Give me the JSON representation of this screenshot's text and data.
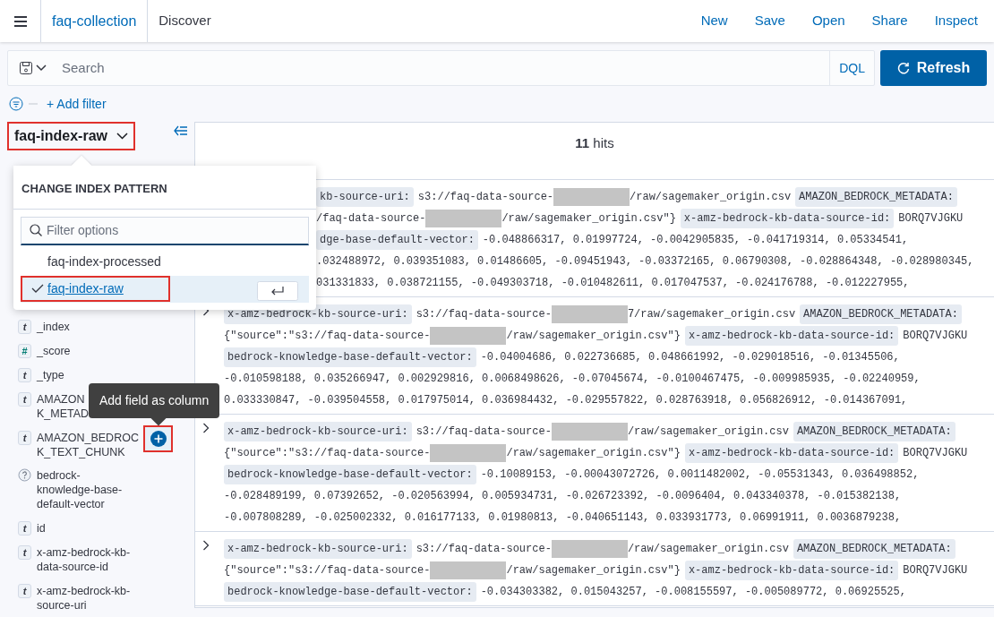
{
  "header": {
    "breadcrumbs": [
      {
        "label": "faq-collection",
        "link": true
      },
      {
        "label": "Discover",
        "link": false
      }
    ],
    "actions": [
      "New",
      "Save",
      "Open",
      "Share",
      "Inspect"
    ]
  },
  "query_bar": {
    "placeholder": "Search",
    "language": "DQL",
    "refresh": "Refresh"
  },
  "add_filter": "+ Add filter",
  "index_picker": {
    "label": "faq-index-raw",
    "highlighted": true
  },
  "popover": {
    "title": "CHANGE INDEX PATTERN",
    "placeholder": "Filter options",
    "options": [
      {
        "label": "faq-index-processed",
        "selected": false,
        "highlighted": false
      },
      {
        "label": "faq-index-raw",
        "selected": true,
        "highlighted": true
      }
    ]
  },
  "fields": [
    {
      "kind": "string",
      "badge": "t",
      "lines": [
        "_index"
      ],
      "add_button": false
    },
    {
      "kind": "number",
      "badge": "#",
      "lines": [
        "_score"
      ],
      "add_button": false
    },
    {
      "kind": "string",
      "badge": "t",
      "lines": [
        "_type"
      ],
      "add_button": false
    },
    {
      "kind": "string",
      "badge": "t",
      "lines": [
        "AMAZON",
        "K_METAD"
      ],
      "add_button": false
    },
    {
      "kind": "string",
      "badge": "t",
      "lines": [
        "AMAZON_BEDROC",
        "K_TEXT_CHUNK"
      ],
      "add_button": true,
      "highlighted": true
    },
    {
      "kind": "unknown",
      "lines": [
        "bedrock-",
        "knowledge-base-",
        "default-vector"
      ],
      "add_button": false
    },
    {
      "kind": "string",
      "badge": "t",
      "lines": [
        "id"
      ],
      "add_button": false
    },
    {
      "kind": "string",
      "badge": "t",
      "lines": [
        "x-amz-bedrock-kb-",
        "data-source-id"
      ],
      "add_button": false
    },
    {
      "kind": "string",
      "badge": "t",
      "lines": [
        "x-amz-bedrock-kb-",
        "source-uri"
      ],
      "add_button": false
    }
  ],
  "tooltip": "Add field as column",
  "hits": "**11** hits",
  "rows": [
    {
      "covered": true,
      "lines": [
        [
          {
            "kind": "chip",
            "text": "kb-source-uri:"
          },
          {
            "kind": "text",
            "text": "s3://faq-data-source-"
          },
          {
            "kind": "redacted"
          },
          {
            "kind": "text",
            "text": "/raw/sagemaker_origin.csv"
          },
          {
            "kind": "chip",
            "text": "AMAZON_BEDROCK_METADATA:"
          }
        ],
        [
          {
            "kind": "text",
            "text": "/faq-data-source-"
          },
          {
            "kind": "redacted"
          },
          {
            "kind": "text",
            "text": "/raw/sagemaker_origin.csv\"}"
          },
          {
            "kind": "chip",
            "text": "x-amz-bedrock-kb-data-source-id:"
          },
          {
            "kind": "text",
            "text": "BORQ7VJGKU"
          }
        ],
        [
          {
            "kind": "chip",
            "text": "dge-base-default-vector:"
          },
          {
            "kind": "text",
            "text": "-0.048866317, 0.01997724, -0.0042905835, -0.041719314, 0.05334541,"
          }
        ],
        [
          {
            "kind": "text",
            "text": ".032488972, 0.039351083, 0.01486605, -0.09451943, -0.03372165, 0.06790308, -0.028864348, -0.028980345,"
          }
        ],
        [
          {
            "kind": "text",
            "text": "031331833, 0.038721155, -0.049303718, -0.010482611, 0.017047537, -0.024176788, -0.012227955,"
          }
        ]
      ]
    },
    {
      "covered": false,
      "lines": [
        [
          {
            "kind": "chip",
            "text": "x-amz-bedrock-kb-source-uri:"
          },
          {
            "kind": "text",
            "text": "s3://faq-data-source-"
          },
          {
            "kind": "redacted"
          },
          {
            "kind": "text",
            "text": "7/raw/sagemaker_origin.csv"
          },
          {
            "kind": "chip",
            "text": "AMAZON_BEDROCK_METADATA:"
          }
        ],
        [
          {
            "kind": "text",
            "text": "{\"source\":\"s3://faq-data-source-"
          },
          {
            "kind": "redacted"
          },
          {
            "kind": "text",
            "text": "/raw/sagemaker_origin.csv\"}"
          },
          {
            "kind": "chip",
            "text": "x-amz-bedrock-kb-data-source-id:"
          },
          {
            "kind": "text",
            "text": "BORQ7VJGKU"
          }
        ],
        [
          {
            "kind": "chip",
            "text": "bedrock-knowledge-base-default-vector:"
          },
          {
            "kind": "text",
            "text": "-0.04004686, 0.022736685, 0.048661992, -0.029018516, -0.01345506,"
          }
        ],
        [
          {
            "kind": "text",
            "text": "-0.010598188, 0.035266947, 0.002929816, 0.0068498626, -0.07045674, -0.0100467475, -0.009985935, -0.02240959,"
          }
        ],
        [
          {
            "kind": "text",
            "text": "0.033330847, -0.039504558, 0.017975014, 0.036984432, -0.029557822, 0.028763918, 0.056826912, -0.014367091,"
          }
        ]
      ]
    },
    {
      "covered": false,
      "lines": [
        [
          {
            "kind": "chip",
            "text": "x-amz-bedrock-kb-source-uri:"
          },
          {
            "kind": "text",
            "text": "s3://faq-data-source-"
          },
          {
            "kind": "redacted"
          },
          {
            "kind": "text",
            "text": "/raw/sagemaker_origin.csv"
          },
          {
            "kind": "chip",
            "text": "AMAZON_BEDROCK_METADATA:"
          }
        ],
        [
          {
            "kind": "text",
            "text": "{\"source\":\"s3://faq-data-source-"
          },
          {
            "kind": "redacted"
          },
          {
            "kind": "text",
            "text": "/raw/sagemaker_origin.csv\"}"
          },
          {
            "kind": "chip",
            "text": "x-amz-bedrock-kb-data-source-id:"
          },
          {
            "kind": "text",
            "text": "BORQ7VJGKU"
          }
        ],
        [
          {
            "kind": "chip",
            "text": "bedrock-knowledge-base-default-vector:"
          },
          {
            "kind": "text",
            "text": "-0.10089153, -0.00043072726, 0.0011482002, -0.05531343, 0.036498852,"
          }
        ],
        [
          {
            "kind": "text",
            "text": "-0.028489199, 0.07392652, -0.020563994, 0.005934731, -0.026723392, -0.0096404, 0.043340378, -0.015382138,"
          }
        ],
        [
          {
            "kind": "text",
            "text": "-0.007808289, -0.025002332, 0.016177133, 0.01980813, -0.040651143, 0.033931773, 0.06991911, 0.0036879238,"
          }
        ]
      ]
    },
    {
      "covered": false,
      "lines": [
        [
          {
            "kind": "chip",
            "text": "x-amz-bedrock-kb-source-uri:"
          },
          {
            "kind": "text",
            "text": "s3://faq-data-source-"
          },
          {
            "kind": "redacted"
          },
          {
            "kind": "text",
            "text": "/raw/sagemaker_origin.csv"
          },
          {
            "kind": "chip",
            "text": "AMAZON_BEDROCK_METADATA:"
          }
        ],
        [
          {
            "kind": "text",
            "text": "{\"source\":\"s3://faq-data-source-"
          },
          {
            "kind": "redacted"
          },
          {
            "kind": "text",
            "text": "/raw/sagemaker_origin.csv\"}"
          },
          {
            "kind": "chip",
            "text": "x-amz-bedrock-kb-data-source-id:"
          },
          {
            "kind": "text",
            "text": "BORQ7VJGKU"
          }
        ],
        [
          {
            "kind": "chip",
            "text": "bedrock-knowledge-base-default-vector:"
          },
          {
            "kind": "text",
            "text": "-0.034303382, 0.015043257, -0.008155597, -0.005089772, 0.06925525,"
          }
        ]
      ]
    }
  ]
}
